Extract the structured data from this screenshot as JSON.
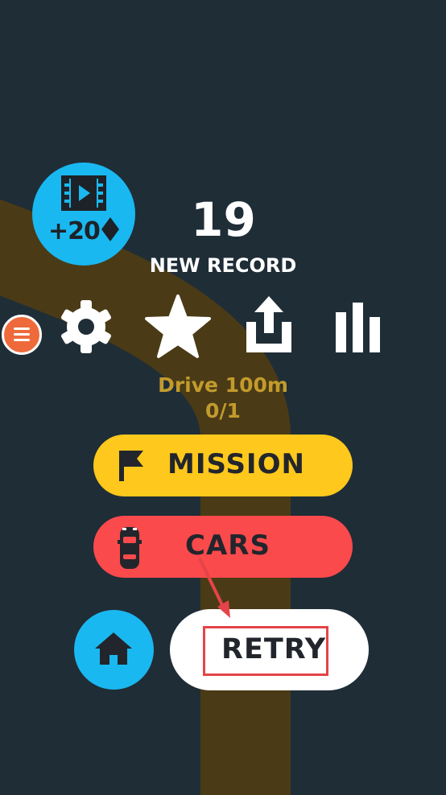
{
  "colors": {
    "background": "#1f2d37",
    "road": "#4a3b16",
    "video_button": "#1ab8f0",
    "mission_button": "#fec81c",
    "cars_button": "#fb4a4c",
    "retry_button": "#ffffff",
    "mission_text": "#c39b2c",
    "menu_button": "#ee6a3a",
    "annotation": "#e44448"
  },
  "video_reward": {
    "icon": "film-play-icon",
    "label": "+20",
    "currency_icon": "diamond-icon"
  },
  "score": {
    "value": "19",
    "label": "NEW RECORD"
  },
  "icon_row": [
    "settings-gear-icon",
    "star-icon",
    "share-icon",
    "leaderboard-icon"
  ],
  "side_menu": {
    "icon": "menu-lines-icon"
  },
  "current_mission": {
    "text": "Drive 100m",
    "progress": "0/1"
  },
  "buttons": {
    "mission": {
      "label": "MISSION",
      "icon": "flag-icon"
    },
    "cars": {
      "label": "CARS",
      "icon": "car-icon"
    },
    "home": {
      "icon": "home-icon"
    },
    "retry": {
      "label": "RETRY"
    }
  }
}
